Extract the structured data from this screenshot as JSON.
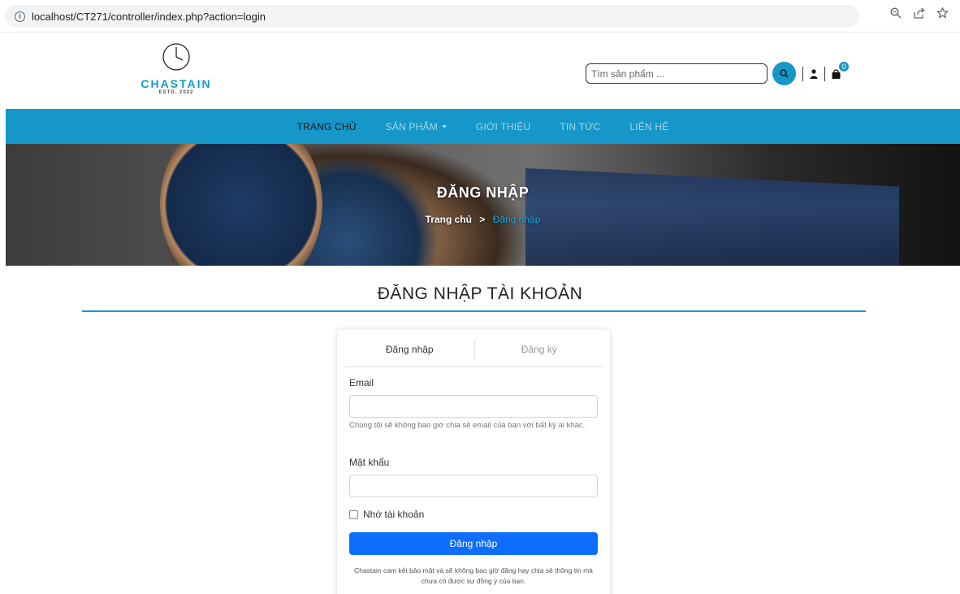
{
  "browser": {
    "url": "localhost/CT271/controller/index.php?action=login",
    "icons": [
      "info-icon",
      "zoom-icon",
      "share-icon",
      "bookmark-star-icon"
    ]
  },
  "header": {
    "brand": "CHASTAIN",
    "estd": "ESTD. 2022",
    "search_placeholder": "Tìm sản phẩm ...",
    "cart_count": "0"
  },
  "nav": {
    "items": [
      {
        "label": "TRANG CHỦ",
        "active": true
      },
      {
        "label": "SẢN PHẨM",
        "active": false
      },
      {
        "label": "GIỚI THIỆU",
        "active": false
      },
      {
        "label": "TIN TỨC",
        "active": false
      },
      {
        "label": "LIÊN HỆ",
        "active": false
      }
    ]
  },
  "hero": {
    "title": "ĐĂNG NHẬP",
    "breadcrumb_home": "Trang chủ",
    "breadcrumb_sep": ">",
    "breadcrumb_current": "Đăng nhập"
  },
  "section": {
    "title": "ĐĂNG NHẬP TÀI KHOẢN"
  },
  "form": {
    "tab_login": "Đăng nhập",
    "tab_register": "Đăng ký",
    "email_label": "Email",
    "email_value": "",
    "email_help": "Chúng tôi sẽ không bao giờ chia sẻ email của bạn với bất kỳ ai khác.",
    "password_label": "Mật khẩu",
    "password_value": "",
    "remember_label": "Nhớ tài khoản",
    "submit_label": "Đăng nhập",
    "note": "Chastain cam kết bảo mật và sẽ không bao giờ đăng hay chia sẻ thông tin mà chưa có được sự đồng ý của bạn."
  },
  "colors": {
    "brand": "#1597c9",
    "button": "#0d6efd"
  }
}
